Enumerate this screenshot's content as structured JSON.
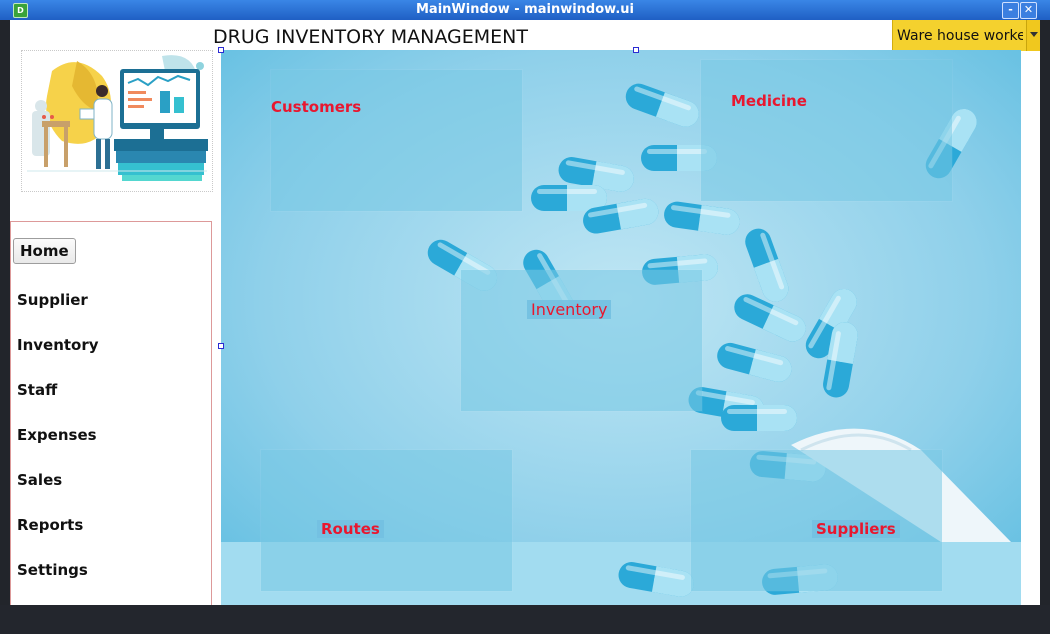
{
  "window": {
    "title": "MainWindow - mainwindow.ui",
    "app_icon_letter": "D",
    "minimize_glyph": "-",
    "close_glyph": "✕"
  },
  "header": {
    "heading": "DRUG INVENTORY MANAGEMENT",
    "role_combo": {
      "selected": "Ware house worke"
    }
  },
  "sidebar": {
    "items": [
      {
        "label": "Home"
      },
      {
        "label": "Supplier"
      },
      {
        "label": "Inventory"
      },
      {
        "label": "Staff"
      },
      {
        "label": "Expenses"
      },
      {
        "label": "Sales"
      },
      {
        "label": "Reports"
      },
      {
        "label": "Settings"
      }
    ]
  },
  "tiles": {
    "customers": {
      "label": "Customers"
    },
    "medicine": {
      "label": "Medicine"
    },
    "inventory": {
      "label": "Inventory"
    },
    "routes": {
      "label": "Routes"
    },
    "suppliers": {
      "label": "Suppliers"
    }
  },
  "colors": {
    "accent_yellow": "#f4d12e",
    "tile_label_red": "#e8172f",
    "title_blue": "#2f74dc",
    "pill_blue": "#35b4dd"
  }
}
